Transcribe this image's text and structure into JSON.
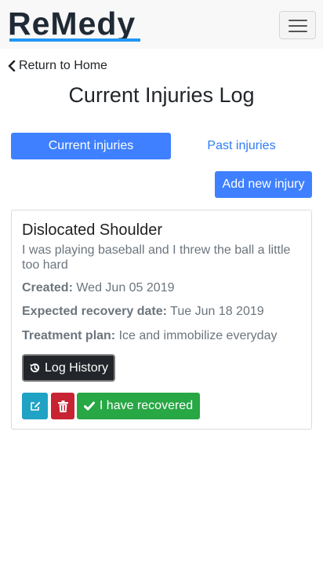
{
  "brand": {
    "name": "ReMedy",
    "accent": "#2196f3"
  },
  "nav": {
    "back_label": "Return to Home"
  },
  "page": {
    "title": "Current Injuries Log"
  },
  "tabs": [
    {
      "label": "Current injuries",
      "active": true
    },
    {
      "label": "Past injuries",
      "active": false
    }
  ],
  "actions": {
    "add_label": "Add new injury"
  },
  "injury": {
    "title": "Dislocated Shoulder",
    "description": "I was playing baseball and I threw the ball a little too hard",
    "created_label": "Created:",
    "created_value": "Wed Jun 05 2019",
    "recovery_label": "Expected recovery date:",
    "recovery_value": "Tue Jun 18 2019",
    "treatment_label": "Treatment plan:",
    "treatment_value": "Ice and immobilize everyday",
    "log_history_label": "Log History",
    "recovered_label": "I have recovered"
  },
  "icons": {
    "menu": "hamburger-icon",
    "back": "chevron-left-icon",
    "history": "history-icon",
    "edit": "edit-icon",
    "delete": "trash-icon",
    "recovered": "check-icon"
  },
  "colors": {
    "primary": "#3e80ff",
    "info": "#1fa2c4",
    "danger": "#c82333",
    "success": "#28a745",
    "dark": "#222529"
  }
}
